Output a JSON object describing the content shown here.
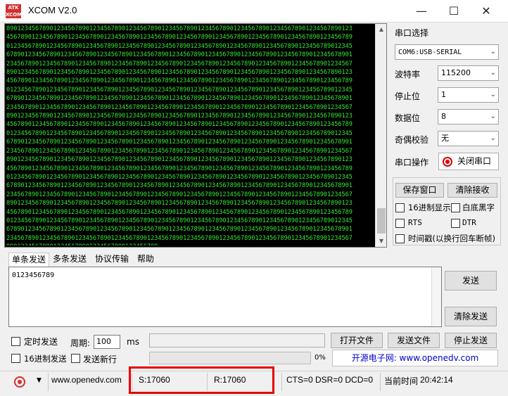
{
  "window": {
    "title": "XCOM V2.0",
    "logo_text": "ATK XCOM",
    "minimize_label": "—",
    "maximize_label": "☐",
    "close_label": "✕"
  },
  "terminal": {
    "text": "890123456789012345678901234567890123456789012345678901234567890123456789012345678901234567890123\n456789012345678901234567890123456789012345678901234567890123456789012345678901234567890123456789\n012345678901234567890123456789012345678901234567890123456789012345678901234567890123456789012345\n678901234567890123456789012345678901234567890123456789012345678901234567890123456789012345678901\n234567890123456789012345678901234567890123456789012345678901234567890123456789012345678901234567\n890123456789012345678901234567890123456789012345678901234567890123456789012345678901234567890123\n456789012345678901234567890123456789012345678901234567890123456789012345678901234567890123456789\n012345678901234567890123456789012345678901234567890123456789012345678901234567890123456789012345\n678901234567890123456789012345678901234567890123456789012345678901234567890123456789012345678901\n234567890123456789012345678901234567890123456789012345678901234567890123456789012345678901234567\n890123456789012345678901234567890123456789012345678901234567890123456789012345678901234567890123\n456789012345678901234567890123456789012345678901234567890123456789012345678901234567890123456789\n012345678901234567890123456789012345678901234567890123456789012345678901234567890123456789012345\n678901234567890123456789012345678901234567890123456789012345678901234567890123456789012345678901\n234567890123456789012345678901234567890123456789012345678901234567890123456789012345678901234567\n890123456789012345678901234567890123456789012345678901234567890123456789012345678901234567890123\n456789012345678901234567890123456789012345678901234567890123456789012345678901234567890123456789\n012345678901234567890123456789012345678901234567890123456789012345678901234567890123456789012345\n678901234567890123456789012345678901234567890123456789012345678901234567890123456789012345678901\n234567890123456789012345678901234567890123456789012345678901234567890123456789012345678901234567\n890123456789012345678901234567890123456789012345678901234567890123456789012345678901234567890123\n456789012345678901234567890123456789012345678901234567890123456789012345678901234567890123456789\n012345678901234567890123456789012345678901234567890123456789012345678901234567890123456789012345\n678901234567890123456789012345678901234567890123456789012345678901234567890123456789012345678901\n234567890123456789012345678901234567890123456789012345678901234567890123456789012345678901234567\n890123456789012345678901234567890123456789"
  },
  "settings": {
    "port_select_label": "串口选择",
    "port_value": "COM6:USB-SERIAL",
    "baud_label": "波特率",
    "baud_value": "115200",
    "stopbits_label": "停止位",
    "stopbits_value": "1",
    "databits_label": "数据位",
    "databits_value": "8",
    "parity_label": "奇偶校验",
    "parity_value": "无",
    "port_op_label": "串口操作",
    "close_port_label": "关闭串口"
  },
  "receive_options": {
    "save_window_label": "保存窗口",
    "clear_receive_label": "清除接收",
    "hex_display_label": "16进制显示",
    "white_bg_label": "白底黑字",
    "rts_label": "RTS",
    "dtr_label": "DTR",
    "timestamp_label": "时间戳(以换行回车断帧)"
  },
  "tabs": [
    {
      "label": "单条发送"
    },
    {
      "label": "多条发送"
    },
    {
      "label": "协议传输"
    },
    {
      "label": "帮助"
    }
  ],
  "send": {
    "input_value": "0123456789",
    "send_label": "发送",
    "clear_send_label": "清除发送",
    "timed_send_label": "定时发送",
    "period_label": "周期:",
    "period_value": "100",
    "period_unit": "ms",
    "open_file_label": "打开文件",
    "send_file_label": "发送文件",
    "stop_send_label": "停止发送",
    "hex_send_label": "16进制发送",
    "send_newline_label": "发送新行",
    "progress_value": "0%",
    "progress_fraction": 0,
    "website": "开源电子网: www.openedv.com"
  },
  "statusbar": {
    "site": "www.openedv.com",
    "sent": "S:17060",
    "received": "R:17060",
    "lines": "CTS=0 DSR=0 DCD=0",
    "time_label": "当前时间",
    "time_value": "20:42:14"
  },
  "colors": {
    "terminal_bg": "#000000",
    "terminal_fg": "#32e832",
    "highlight": "#e60000",
    "link_blue": "#0000cc"
  }
}
